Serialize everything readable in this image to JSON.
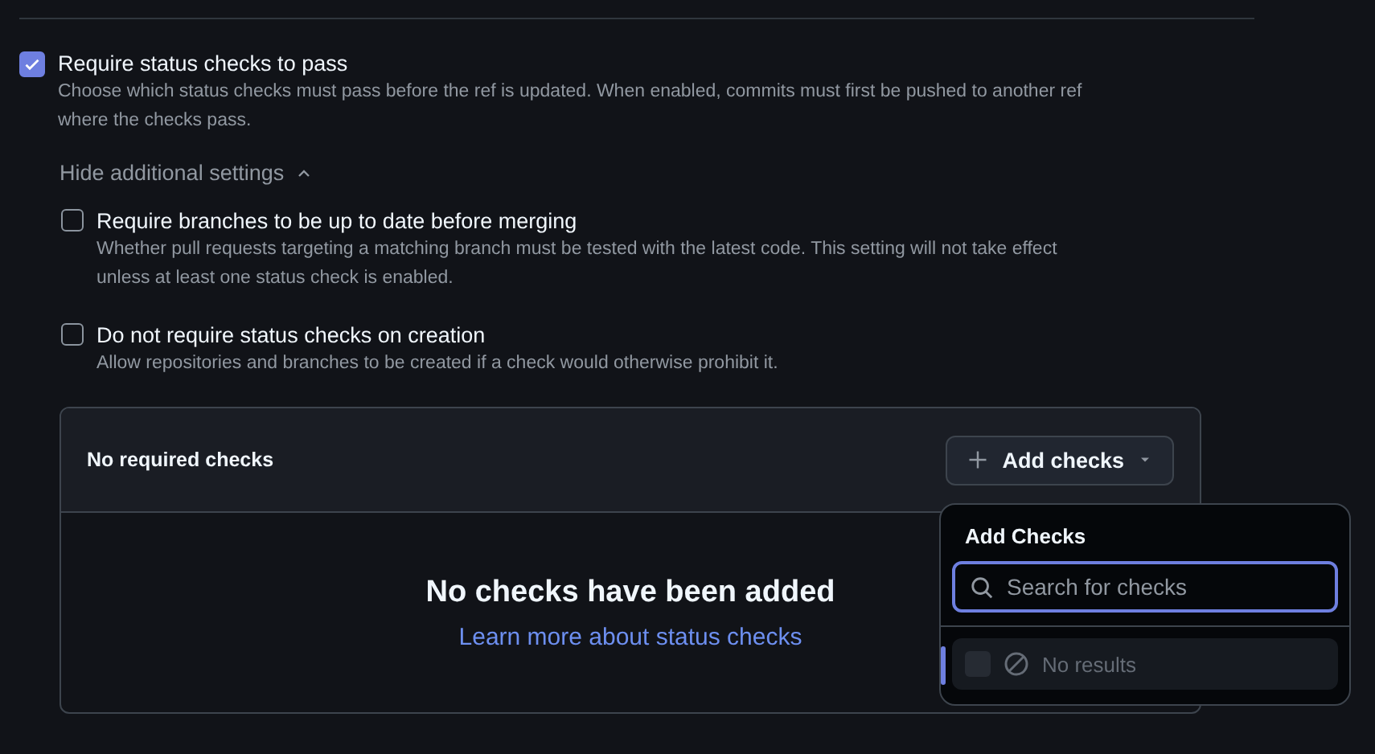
{
  "main_option": {
    "label": "Require status checks to pass",
    "description": "Choose which status checks must pass before the ref is updated. When enabled, commits must first be pushed to another ref where the checks pass.",
    "checked": true
  },
  "toggle": {
    "label": "Hide additional settings",
    "expanded": true
  },
  "sub_options": [
    {
      "label": "Require branches to be up to date before merging",
      "description": "Whether pull requests targeting a matching branch must be tested with the latest code. This setting will not take effect unless at least one status check is enabled.",
      "checked": false
    },
    {
      "label": "Do not require status checks on creation",
      "description": "Allow repositories and branches to be created if a check would otherwise prohibit it.",
      "checked": false
    }
  ],
  "checks_panel": {
    "title": "No required checks",
    "add_button": "Add checks",
    "empty_title": "No checks have been added",
    "learn_link": "Learn more about status checks"
  },
  "dropdown": {
    "title": "Add Checks",
    "search": {
      "placeholder": "Search for checks"
    },
    "results": [
      {
        "label": "No results",
        "disabled": true
      }
    ]
  }
}
